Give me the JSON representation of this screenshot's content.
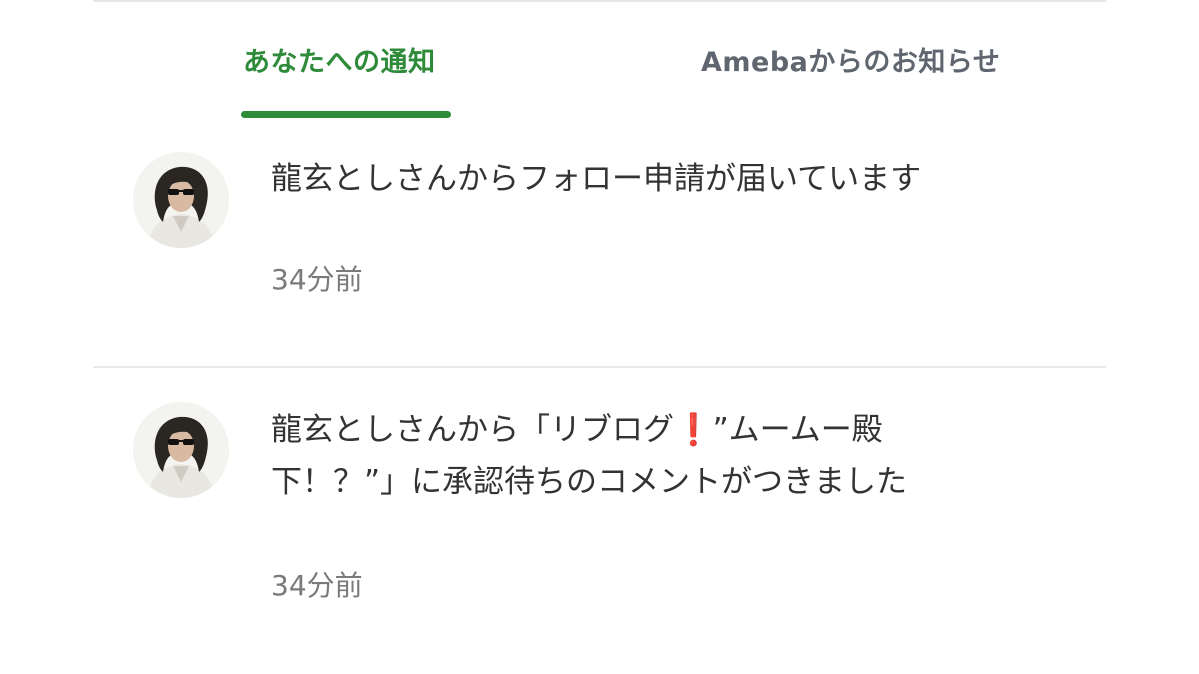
{
  "tabs": {
    "yours": "あなたへの通知",
    "ameba": "Amebaからのお知らせ"
  },
  "notifications": [
    {
      "message": "龍玄としさんからフォロー申請が届いています",
      "time": "34分前"
    },
    {
      "message_line1_prefix": "龍玄としさんから「リブログ",
      "message_exclaim": "❗",
      "message_line1_suffix": "”ムームー殿",
      "message_line2": "下！？”」に承認待ちのコメントがつきました",
      "time": "34分前"
    }
  ],
  "colors": {
    "accent": "#2e8b3a",
    "tab_inactive": "#5f6670",
    "text": "#333333",
    "time": "#7a7a7a",
    "exclaim": "#d9312b"
  }
}
